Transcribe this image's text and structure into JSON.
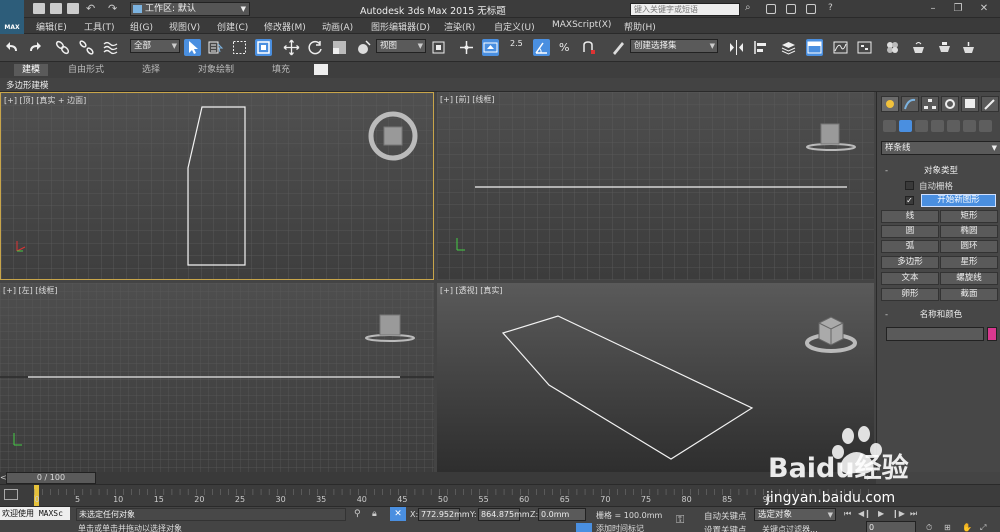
{
  "app": {
    "logo": "MAX",
    "title": "Autodesk 3ds Max  2015      无标题",
    "workspace": "工作区: 默认",
    "search_placeholder": "键入关键字或短语"
  },
  "menu": [
    "编辑(E)",
    "工具(T)",
    "组(G)",
    "视图(V)",
    "创建(C)",
    "修改器(M)",
    "动画(A)",
    "图形编辑器(D)",
    "渲染(R)",
    "自定义(U)",
    "MAXScript(X)",
    "帮助(H)"
  ],
  "toolbar": {
    "selection_filter": "全部",
    "ref_coord": "视图",
    "snap_value": "2.5",
    "named_selection": "创建选择集"
  },
  "ribbon": {
    "tabs": [
      "建模",
      "自由形式",
      "选择",
      "对象绘制",
      "填充"
    ],
    "active_tab": "建模",
    "sub_label": "多边形建模"
  },
  "viewports": {
    "top": "[+] [顶] [真实 + 边面]",
    "front": "[+] [前] [线框]",
    "left": "[+] [左] [线框]",
    "perspective": "[+] [透视] [真实]"
  },
  "command_panel": {
    "category_dropdown": "样条线",
    "object_type_title": "对象类型",
    "auto_grid": "自动栅格",
    "start_new_shape": "开始新图形",
    "object_buttons": [
      "线",
      "矩形",
      "圆",
      "椭圆",
      "弧",
      "圆环",
      "多边形",
      "星形",
      "文本",
      "螺旋线",
      "卵形",
      "截面"
    ],
    "name_color_title": "名称和颜色",
    "color": "#d9388f"
  },
  "timeline": {
    "frame_display": "0 / 100",
    "ticks": [
      "0",
      "5",
      "10",
      "15",
      "20",
      "25",
      "30",
      "35",
      "40",
      "45",
      "50",
      "55",
      "60",
      "65",
      "70",
      "75",
      "80",
      "85",
      "90"
    ]
  },
  "status": {
    "maxscript_label": "欢迎使用 MAXSc",
    "selection_status": "未选定任何对象",
    "prompt": "单击或单击并拖动以选择对象",
    "x_label": "X:",
    "x_value": "772.952mm",
    "y_label": "Y:",
    "y_value": "864.875mm",
    "z_label": "Z:",
    "z_value": "0.0mm",
    "grid": "栅格 = 100.0mm",
    "add_time_tag": "添加时间标记",
    "auto_key": "自动关键点",
    "set_key": "设置关键点",
    "key_filter_dropdown": "选定对象",
    "key_filters": "关键点过滤器...",
    "frame_value": "0"
  },
  "watermark": {
    "brand": "Baidu经验",
    "url": "jingyan.baidu.com"
  }
}
